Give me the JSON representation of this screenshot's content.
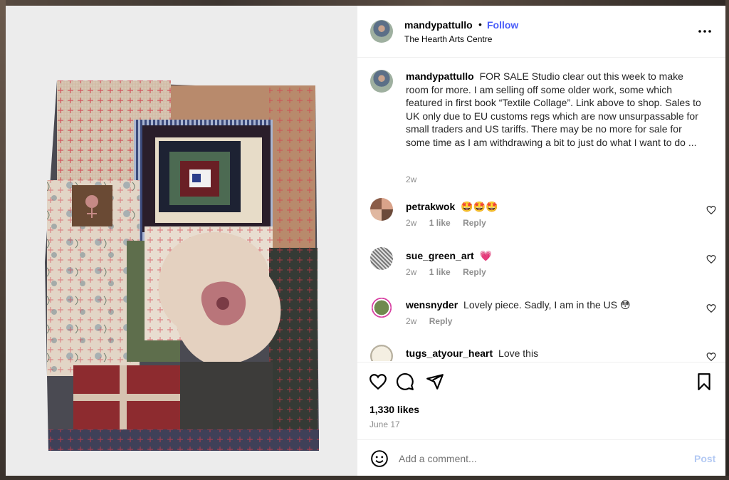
{
  "post": {
    "username": "mandypattullo",
    "dot": "•",
    "follow_label": "Follow",
    "location": "The Hearth Arts Centre"
  },
  "caption": {
    "username": "mandypattullo",
    "text": "FOR SALE Studio clear out this week to make room for more. I am selling off some older work, some which featured in first book “Textile Collage”. Link above to shop. Sales to UK only due to EU customs regs which are now unsurpassable for small traders and US tariffs. There may be no more for sale for some time as I am withdrawing a bit to just do what I want to do ...",
    "time": "2w"
  },
  "comments": [
    {
      "username": "petrakwok",
      "text": "🤩🤩🤩",
      "time": "2w",
      "likes": "1 like",
      "reply": "Reply"
    },
    {
      "username": "sue_green_art",
      "text": "💗",
      "time": "2w",
      "likes": "1 like",
      "reply": "Reply"
    },
    {
      "username": "wensnyder",
      "text": "Lovely piece. Sadly, I am in the US 😳",
      "time": "2w",
      "likes": "",
      "reply": "Reply"
    },
    {
      "username": "tugs_atyour_heart",
      "text": "Love this",
      "time": "",
      "likes": "",
      "reply": ""
    }
  ],
  "likes_count": "1,330 likes",
  "date": "June 17",
  "add_comment": {
    "placeholder": "Add a comment...",
    "post_label": "Post"
  },
  "colors": {
    "follow": "#4a5df9",
    "post_disabled": "#b3c9f3",
    "meta_gray": "#8e8e8e"
  }
}
